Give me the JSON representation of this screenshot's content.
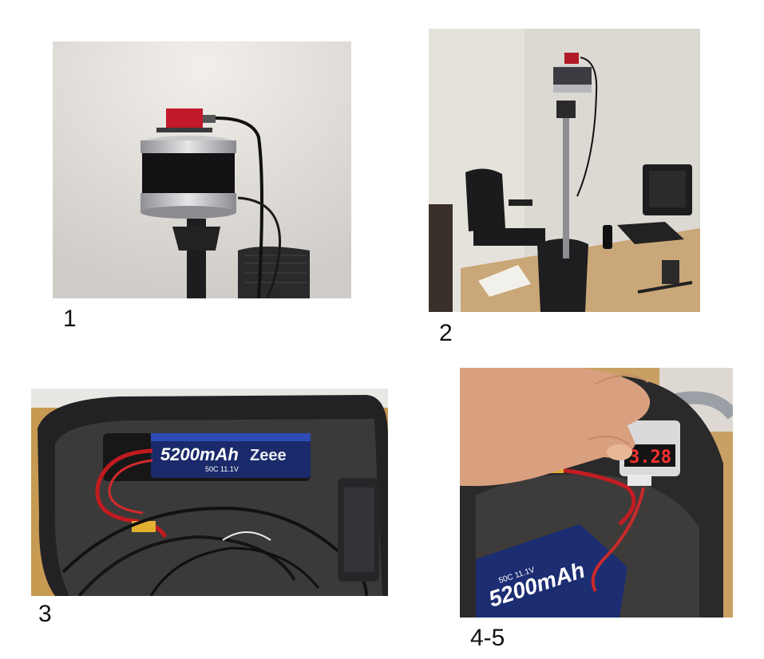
{
  "photos": [
    {
      "caption": "1",
      "subject": "lidar-sensor-with-red-camera"
    },
    {
      "caption": "2",
      "subject": "sensor-on-pole-in-office"
    },
    {
      "caption": "3",
      "subject": "battery-in-foam-case",
      "battery_label": "5200mAh",
      "brand_label": "Zeee",
      "spec_label": "50C 11.1V"
    },
    {
      "caption": "4-5",
      "subject": "hand-holding-voltage-checker",
      "voltage_display": "3.28",
      "battery_label": "5200mAh",
      "spec_label": "50C 11.1V"
    }
  ]
}
